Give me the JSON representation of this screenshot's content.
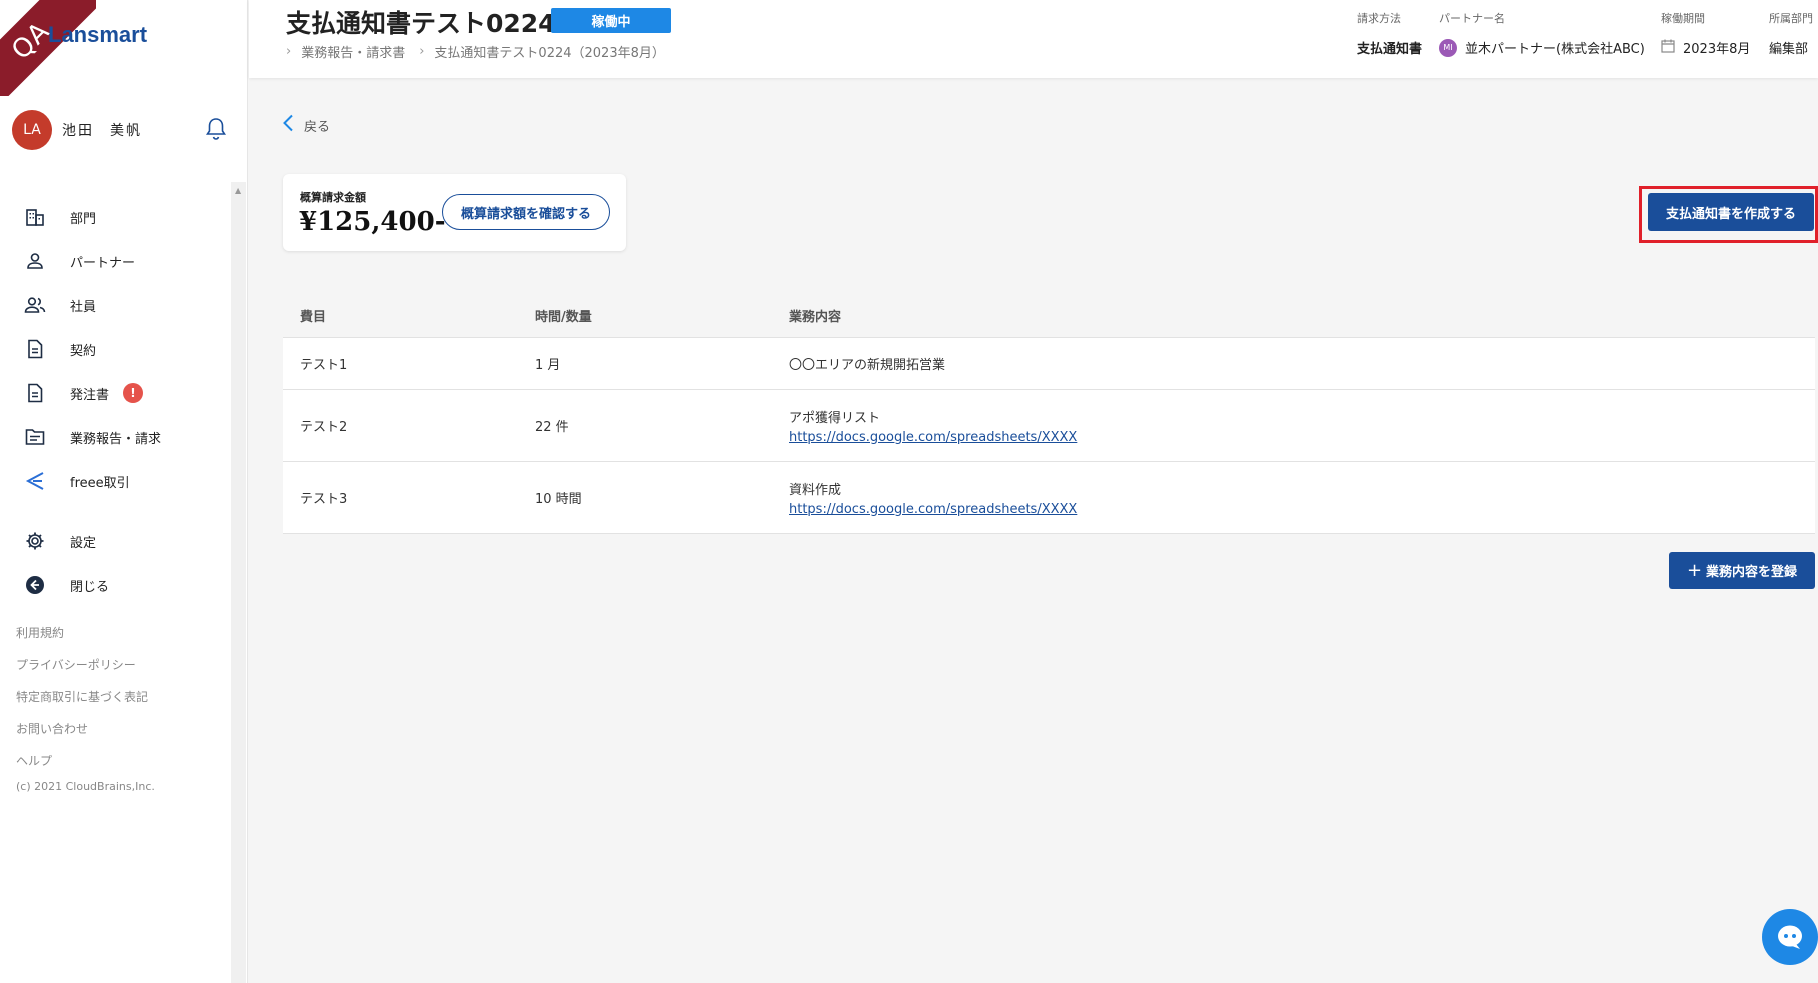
{
  "sidebar": {
    "qa_label": "QA",
    "logo": "Lansmart",
    "user": {
      "initials": "LA",
      "name": "池田　美帆"
    },
    "nav": [
      {
        "label": "部門",
        "icon": "building-icon"
      },
      {
        "label": "パートナー",
        "icon": "person-icon"
      },
      {
        "label": "社員",
        "icon": "people-icon"
      },
      {
        "label": "契約",
        "icon": "document-icon"
      },
      {
        "label": "発注書",
        "icon": "document-icon",
        "badge": "!"
      },
      {
        "label": "業務報告・請求",
        "icon": "folder-icon"
      },
      {
        "label": "freee取引",
        "icon": "freee-icon"
      }
    ],
    "nav_bottom": [
      {
        "label": "設定",
        "icon": "gear-icon"
      },
      {
        "label": "閉じる",
        "icon": "back-circle-icon"
      }
    ],
    "footer_links": [
      "利用規約",
      "プライバシーポリシー",
      "特定商取引に基づく表記",
      "お問い合わせ",
      "ヘルプ"
    ],
    "copyright": "(c) 2021 CloudBrains,Inc."
  },
  "header": {
    "title": "支払通知書テスト0224",
    "status": "稼働中",
    "breadcrumb": [
      "業務報告・請求書",
      "支払通知書テスト0224（2023年8月）"
    ],
    "meta": {
      "billing_method": {
        "label": "請求方法",
        "value": "支払通知書"
      },
      "partner": {
        "label": "パートナー名",
        "initials": "MI",
        "value": "並木パートナー(株式会社ABC)"
      },
      "period": {
        "label": "稼働期間",
        "value": "2023年8月"
      },
      "department": {
        "label": "所属部門",
        "value": "編集部"
      }
    }
  },
  "main": {
    "back_label": "戻る",
    "amount": {
      "label": "概算請求金額",
      "value": "¥125,400-",
      "confirm_button": "概算請求額を確認する"
    },
    "create_button": "支払通知書を作成する",
    "table": {
      "headers": [
        "費目",
        "時間/数量",
        "業務内容"
      ],
      "rows": [
        {
          "item": "テスト1",
          "qty": "1 月",
          "content": "〇〇エリアの新規開拓営業",
          "link": ""
        },
        {
          "item": "テスト2",
          "qty": "22 件",
          "content": "アポ獲得リスト",
          "link": "https://docs.google.com/spreadsheets/XXXX"
        },
        {
          "item": "テスト3",
          "qty": "10 時間",
          "content": "資料作成",
          "link": "https://docs.google.com/spreadsheets/XXXX"
        }
      ]
    },
    "add_button": "業務内容を登録",
    "add_button_icon": "plus-icon"
  },
  "colors": {
    "primary": "#1a4e9a",
    "status": "#1e88e5",
    "highlight": "#e0202a",
    "badge": "#e5534b",
    "avatar": "#c43b2b"
  }
}
